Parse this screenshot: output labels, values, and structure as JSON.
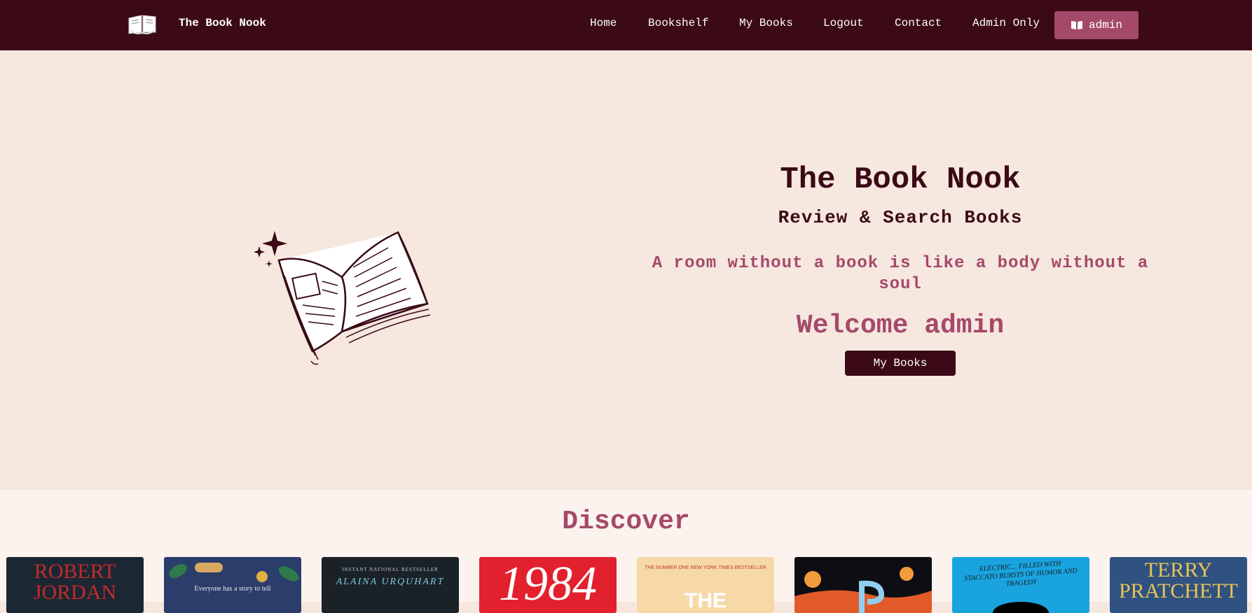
{
  "brand": {
    "name": "The Book Nook",
    "logo_icon": "open-book-icon"
  },
  "nav": {
    "links": [
      "Home",
      "Bookshelf",
      "My Books",
      "Logout",
      "Contact",
      "Admin Only"
    ],
    "user_label": "admin",
    "user_icon": "book-icon"
  },
  "hero": {
    "title": "The Book Nook",
    "subtitle": "Review & Search Books",
    "quote": "A room without a book is like a body without a soul",
    "welcome": "Welcome admin",
    "button_label": "My Books",
    "illustration_icon": "open-book-sparkles-icon"
  },
  "discover": {
    "title": "Discover",
    "covers": [
      {
        "text": "ROBERT JORDAN",
        "bg": "#1b2733",
        "fg": "#c22b2b"
      },
      {
        "text": "Everyone has a story to tell",
        "bg": "#2b3d6b",
        "fg": "#e8e8f0"
      },
      {
        "text": "ALAINA URQUHART",
        "bg": "#1a2228",
        "fg": "#7ec8d8",
        "subtext": "INSTANT NATIONAL BESTSELLER"
      },
      {
        "text": "1984",
        "bg": "#e3202e",
        "fg": "#ffffff"
      },
      {
        "text": "THE",
        "bg": "#f7d9a8",
        "fg": "#ffffff",
        "subtext": "THE NUMBER ONE NEW YORK TIMES BESTSELLER"
      },
      {
        "text": "",
        "bg": "#0d0d14",
        "fg": "#f29b3a"
      },
      {
        "text": "ELECTRIC... FILLED WITH STACCATO BURSTS OF HUMOR AND TRAGEDY",
        "bg": "#19a4e0",
        "fg": "#1a1a1a"
      },
      {
        "text": "TERRY PRATCHETT",
        "bg": "#2f5280",
        "fg": "#e8c45a"
      }
    ]
  },
  "colors": {
    "navbar": "#3b0a16",
    "accent": "#a5496a",
    "hero_bg": "#f6e7df",
    "discover_bg": "#fcf3ef"
  }
}
